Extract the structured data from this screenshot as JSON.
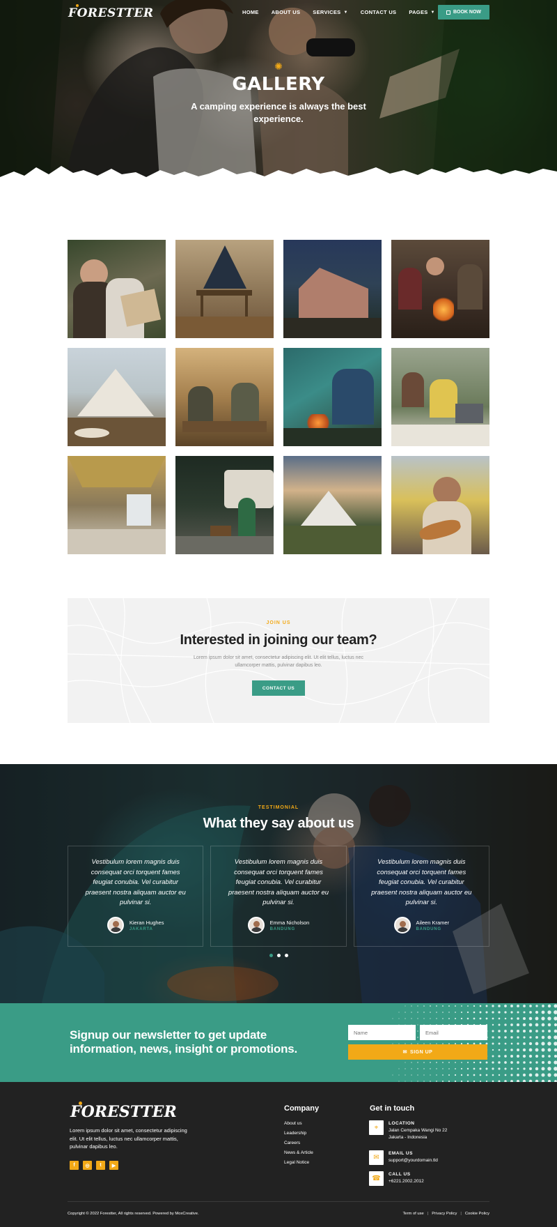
{
  "brand": {
    "logo": "FORESTTER",
    "accent": "#3a9c86",
    "highlight": "#f2a917"
  },
  "nav": {
    "items": [
      {
        "label": "HOME",
        "dropdown": false
      },
      {
        "label": "ABOUT US",
        "dropdown": false
      },
      {
        "label": "SERVICES",
        "dropdown": true
      },
      {
        "label": "CONTACT US",
        "dropdown": false
      },
      {
        "label": "PAGES",
        "dropdown": true
      }
    ],
    "cta": "BOOK NOW"
  },
  "hero": {
    "title": "GALLERY",
    "subtitle_line1": "A camping experience is always the best",
    "subtitle_line2": "experience."
  },
  "gallery": {
    "photos": [
      "friends-hiking-map",
      "glamping-tent-interior",
      "tent-night-lights",
      "campfire-group",
      "bell-tent-deck",
      "dinner-in-tent",
      "tent-campfire-guitar",
      "friends-laptop",
      "tent-interior-yellow",
      "rv-campfire-night",
      "tent-mountain-sunset",
      "man-guitar-van"
    ]
  },
  "join": {
    "kicker": "JOIN US",
    "title": "Interested in joining our team?",
    "text_line1": "Lorem ipsum dolor sit amet, consectetur adipiscing elit. Ut elit tellus, luctus nec",
    "text_line2": "ullamcorper mattis, pulvinar dapibus leo.",
    "button": "CONTACT US"
  },
  "testimonial": {
    "kicker": "TESTIMONIAL",
    "title": "What they say about us",
    "cards": [
      {
        "quote": "Vestibulum lorem magnis duis consequat orci torquent fames feugiat conubia. Vel curabitur praesent nostra aliquam auctor eu pulvinar si.",
        "name": "Kieran Hughes",
        "city": "JAKARTA"
      },
      {
        "quote": "Vestibulum lorem magnis duis consequat orci torquent fames feugiat conubia. Vel curabitur praesent nostra aliquam auctor eu pulvinar si.",
        "name": "Emma Nicholson",
        "city": "BANDUNG"
      },
      {
        "quote": "Vestibulum lorem magnis duis consequat orci torquent fames feugiat conubia. Vel curabitur praesent nostra aliquam auctor eu pulvinar si.",
        "name": "Aileen Kramer",
        "city": "BANDUNG"
      }
    ],
    "active_dot": 0
  },
  "newsletter": {
    "text": "Signup our newsletter to get update information, news, insight or promotions.",
    "name_placeholder": "Name",
    "email_placeholder": "Email",
    "button": "SIGN UP"
  },
  "footer": {
    "logo": "FORESTTER",
    "about": "Lorem ipsum dolor sit amet, consectetur adipiscing elit. Ut elit tellus, luctus nec ullamcorper mattis, pulvinar dapibus leo.",
    "socials": [
      "f",
      "◎",
      "t",
      "▶"
    ],
    "company_title": "Company",
    "company_links": [
      "About us",
      "Leadership",
      "Careers",
      "News & Article",
      "Legal Notice"
    ],
    "contact_title": "Get in touch",
    "location_title": "LOCATION",
    "location_line1": "Jalan Cempaka Wangi No 22",
    "location_line2": "Jakarta - Indonesia",
    "email_title": "EMAIL US",
    "email": "support@yourdomain.tld",
    "call_title": "CALL US",
    "phone": "+6221.2002.2012",
    "copyright": "Copyright © 2022 Forestter, All rights reserved. Powered by MoxCreative.",
    "legal": [
      "Term of use",
      "Privacy Policy",
      "Cookie Policy"
    ]
  }
}
